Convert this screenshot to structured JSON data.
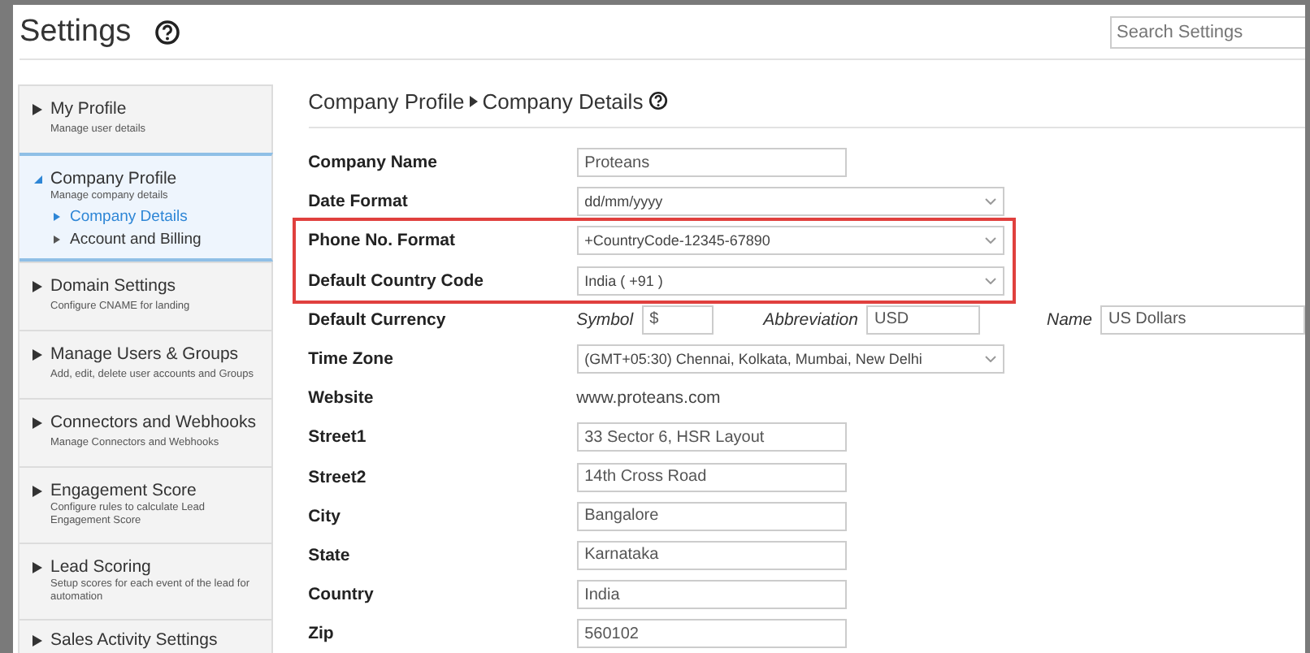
{
  "header": {
    "title": "Settings",
    "search": {
      "placeholder": "Search Settings"
    }
  },
  "sidebar": {
    "items": [
      {
        "title": "My Profile",
        "subtitle": "Manage user details",
        "expanded": false,
        "selected": false
      },
      {
        "title": "Company Profile",
        "subtitle": "Manage company details",
        "expanded": true,
        "selected": true,
        "children": [
          {
            "label": "Company Details",
            "selected": true
          },
          {
            "label": "Account and Billing",
            "selected": false
          }
        ]
      },
      {
        "title": "Domain Settings",
        "subtitle": "Configure CNAME for landing",
        "expanded": false,
        "selected": false
      },
      {
        "title": "Manage Users & Groups",
        "subtitle": "Add, edit, delete user accounts and Groups",
        "expanded": false,
        "selected": false
      },
      {
        "title": "Connectors and Webhooks",
        "subtitle": "Manage Connectors and Webhooks",
        "expanded": false,
        "selected": false
      },
      {
        "title": "Engagement Score",
        "subtitle": "Configure rules to calculate Lead Engagement Score",
        "expanded": false,
        "selected": false
      },
      {
        "title": "Lead Scoring",
        "subtitle": "Setup scores for each event of the lead for automation",
        "expanded": false,
        "selected": false
      },
      {
        "title": "Sales Activity Settings",
        "expanded": false,
        "selected": false
      }
    ]
  },
  "content": {
    "breadcrumb": [
      "Company Profile",
      "Company Details"
    ],
    "fields": [
      {
        "kind": "text",
        "label": "Company Name",
        "value": "Proteans",
        "highlighted": false
      },
      {
        "kind": "select",
        "label": "Date Format",
        "value": "dd/mm/yyyy",
        "highlighted": false
      },
      {
        "kind": "select",
        "label": "Phone No. Format",
        "value": "+CountryCode-12345-67890",
        "highlighted": true
      },
      {
        "kind": "select",
        "label": "Default Country Code",
        "value": "India ( +91 )",
        "highlighted": true
      },
      {
        "kind": "currency",
        "label": "Default Currency",
        "parts": [
          {
            "label": "Symbol",
            "value": "$"
          },
          {
            "label": "Abbreviation",
            "value": "USD"
          },
          {
            "label": "Name",
            "value": "US Dollars"
          }
        ],
        "highlighted": false
      },
      {
        "kind": "select",
        "label": "Time Zone",
        "value": "(GMT+05:30) Chennai, Kolkata, Mumbai, New Delhi",
        "highlighted": false
      },
      {
        "kind": "plain",
        "label": "Website",
        "value": "www.proteans.com",
        "highlighted": false
      },
      {
        "kind": "text",
        "label": "Street1",
        "value": "33 Sector 6, HSR Layout",
        "highlighted": false
      },
      {
        "kind": "text",
        "label": "Street2",
        "value": "14th Cross Road",
        "highlighted": false
      },
      {
        "kind": "text",
        "label": "City",
        "value": "Bangalore",
        "highlighted": false
      },
      {
        "kind": "text",
        "label": "State",
        "value": "Karnataka",
        "highlighted": false
      },
      {
        "kind": "text",
        "label": "Country",
        "value": "India",
        "highlighted": false
      },
      {
        "kind": "text",
        "label": "Zip",
        "value": "560102",
        "highlighted": false
      }
    ]
  }
}
